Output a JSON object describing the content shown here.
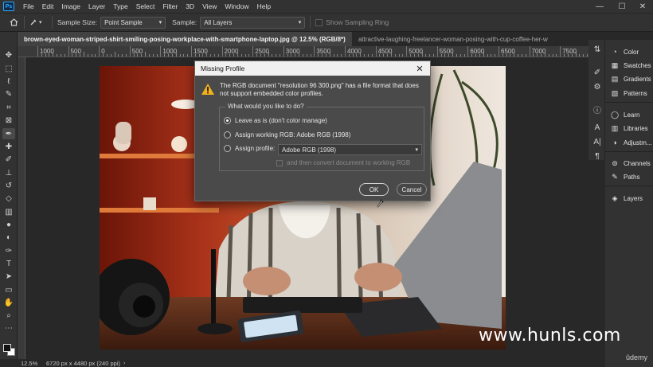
{
  "app": {
    "logo": "Ps"
  },
  "menu": [
    "File",
    "Edit",
    "Image",
    "Layer",
    "Type",
    "Select",
    "Filter",
    "3D",
    "View",
    "Window",
    "Help"
  ],
  "window_controls": {
    "minimize": "—",
    "maximize": "☐",
    "close": "✕"
  },
  "options_bar": {
    "sample_size_label": "Sample Size:",
    "sample_size_value": "Point Sample",
    "sample_label": "Sample:",
    "sample_value": "All Layers",
    "show_ring_label": "Show Sampling Ring"
  },
  "tabs": [
    {
      "label": "brown-eyed-woman-striped-shirt-smiling-posing-workplace-with-smartphone-laptop.jpg @ 12.5% (RGB/8*)",
      "close": "×",
      "active": true
    },
    {
      "label": "attractive-laughing-freelancer-woman-posing-with-cup-coffee-her-w",
      "active": false
    }
  ],
  "ruler_top": [
    "1000",
    "500",
    "0",
    "500",
    "1000",
    "1500",
    "2000",
    "2500",
    "3000",
    "3500",
    "4000",
    "4500",
    "5000",
    "5500",
    "6000",
    "6500",
    "7000",
    "7500"
  ],
  "tools": [
    "move-icon",
    "marquee-icon",
    "lasso-icon",
    "quick-select-icon",
    "crop-icon",
    "frame-icon",
    "eyedropper-icon",
    "healing-icon",
    "brush-icon",
    "stamp-icon",
    "history-brush-icon",
    "eraser-icon",
    "gradient-icon",
    "blur-icon",
    "dodge-icon",
    "pen-icon",
    "type-icon",
    "path-select-icon",
    "rectangle-icon",
    "hand-icon",
    "zoom-icon",
    "more-tools-icon"
  ],
  "panels": [
    {
      "icon": "color-icon",
      "label": "Color"
    },
    {
      "icon": "swatches-icon",
      "label": "Swatches"
    },
    {
      "icon": "gradients-icon",
      "label": "Gradients"
    },
    {
      "icon": "patterns-icon",
      "label": "Patterns"
    },
    {
      "icon": "learn-icon",
      "label": "Learn"
    },
    {
      "icon": "libraries-icon",
      "label": "Libraries"
    },
    {
      "icon": "adjustments-icon",
      "label": "Adjustm..."
    },
    {
      "icon": "channels-icon",
      "label": "Channels"
    },
    {
      "icon": "paths-icon",
      "label": "Paths"
    },
    {
      "icon": "layers-icon",
      "label": "Layers"
    }
  ],
  "status": {
    "zoom": "12.5%",
    "doc_info": "6720 px x 4480 px (240 ppi)"
  },
  "dialog": {
    "title": "Missing Profile",
    "close": "✕",
    "message": "The RGB document \"resolution 96 300.png\" has a file format that does not support embedded color profiles.",
    "question": "What would you like to do?",
    "options": [
      {
        "label": "Leave as is (don't color manage)",
        "selected": true
      },
      {
        "label": "Assign working RGB:  Adobe RGB (1998)",
        "selected": false
      },
      {
        "label": "Assign profile:",
        "selected": false
      }
    ],
    "profile_value": "Adobe RGB (1998)",
    "convert_label": "and then convert document to working RGB",
    "ok_label": "OK",
    "cancel_label": "Cancel"
  },
  "watermark": "www.hunls.com",
  "brand": "ûdemy"
}
